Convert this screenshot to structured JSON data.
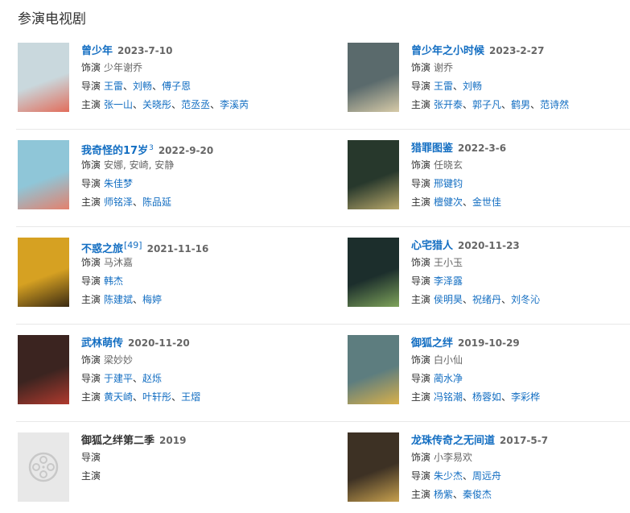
{
  "section_title": "参演电视剧",
  "labels": {
    "role": "饰演",
    "director": "导演",
    "star": "主演"
  },
  "cards": [
    {
      "title": "曾少年",
      "date": "2023-7-10",
      "role": "少年谢乔",
      "directors": [
        "王雷",
        "刘畅",
        "傅子恩"
      ],
      "stars": [
        "张一山",
        "关晓彤",
        "范丞丞",
        "李溪芮"
      ],
      "poster_color": "#c9d8dd",
      "poster_accent": "#e26d5b"
    },
    {
      "title": "曾少年之小时候",
      "date": "2023-2-27",
      "role": "谢乔",
      "directors": [
        "王雷",
        "刘畅"
      ],
      "stars": [
        "张开泰",
        "郭子凡",
        "鹤男",
        "范诗然"
      ],
      "poster_color": "#5a6a6c",
      "poster_accent": "#d7cba8"
    },
    {
      "title": "我奇怪的17岁",
      "sup": "3",
      "date": "2022-9-20",
      "role": "安娜, 安崎, 安静",
      "directors": [
        "朱佳梦"
      ],
      "stars": [
        "师铭泽",
        "陈品延"
      ],
      "poster_color": "#8fc6d8",
      "poster_accent": "#e4806c"
    },
    {
      "title": "猎罪图鉴",
      "date": "2022-3-6",
      "role": "任晓玄",
      "directors": [
        "邢键钧"
      ],
      "stars": [
        "檀健次",
        "金世佳"
      ],
      "poster_color": "#27382c",
      "poster_accent": "#b8a86a"
    },
    {
      "title": "不惑之旅",
      "sup": "[49]",
      "date": "2021-11-16",
      "role": "马沐嘉",
      "directors": [
        "韩杰"
      ],
      "stars": [
        "陈建斌",
        "梅婷"
      ],
      "poster_color": "#d6a122",
      "poster_accent": "#3a2a12"
    },
    {
      "title": "心宅猎人",
      "date": "2020-11-23",
      "role": "王小玉",
      "directors": [
        "李泽露"
      ],
      "stars": [
        "侯明昊",
        "祝绪丹",
        "刘冬沁"
      ],
      "poster_color": "#1c2e2c",
      "poster_accent": "#7ea35a"
    },
    {
      "title": "武林萌传",
      "date": "2020-11-20",
      "role": "梁妙妙",
      "directors": [
        "于建平",
        "赵烁"
      ],
      "stars": [
        "黄天崎",
        "叶轩彤",
        "王熠"
      ],
      "poster_color": "#3b2420",
      "poster_accent": "#b03a2e"
    },
    {
      "title": "御狐之绊",
      "date": "2019-10-29",
      "role": "白小仙",
      "directors": [
        "蔺水净"
      ],
      "stars": [
        "冯铭潮",
        "杨蓉如",
        "李彩桦"
      ],
      "poster_color": "#5d7d7f",
      "poster_accent": "#d9b04a"
    },
    {
      "title": "御狐之绊第二季",
      "date": "2019",
      "role": "",
      "directors": [],
      "stars": [],
      "placeholder": true
    },
    {
      "title": "龙珠传奇之无间道",
      "date": "2017-5-7",
      "role": "小李易欢",
      "directors": [
        "朱少杰",
        "周远舟"
      ],
      "stars": [
        "杨紫",
        "秦俊杰"
      ],
      "poster_color": "#3d3124",
      "poster_accent": "#c7a04e"
    }
  ]
}
